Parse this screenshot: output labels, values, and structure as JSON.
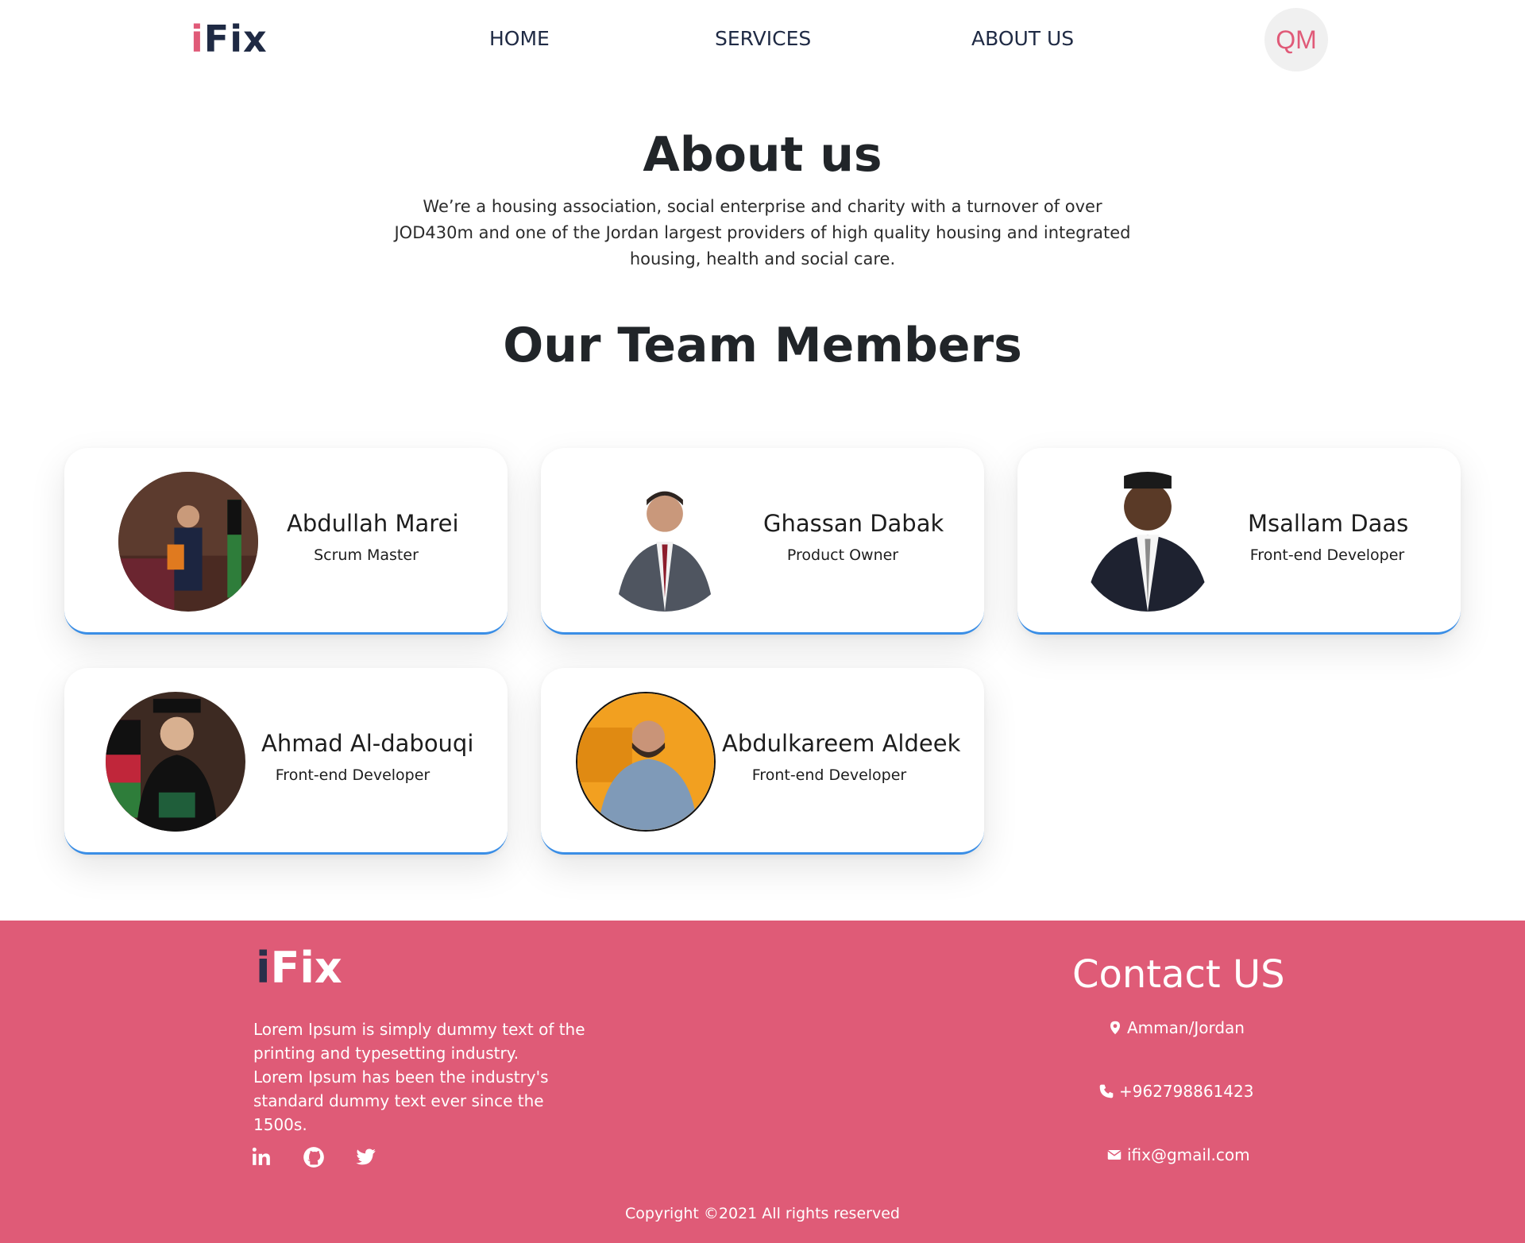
{
  "nav": {
    "logo": "iFix",
    "links": [
      "HOME",
      "SERVICES",
      "ABOUT US"
    ],
    "avatar_initials": "QM"
  },
  "about": {
    "title": "About us",
    "text": "We’re a housing association, social enterprise and charity with a turnover of over JOD430m and one of the Jordan largest providers of high quality housing and integrated housing, health and social care."
  },
  "team": {
    "title": "Our Team Members",
    "members": [
      {
        "name": "Abdullah Marei",
        "role": "Scrum Master"
      },
      {
        "name": "Ghassan Dabak",
        "role": "Product Owner"
      },
      {
        "name": "Msallam Daas",
        "role": "Front-end Developer"
      },
      {
        "name": "Ahmad Al-dabouqi",
        "role": "Front-end Developer"
      },
      {
        "name": "Abdulkareem Aldeek",
        "role": "Front-end Developer"
      }
    ]
  },
  "footer": {
    "logo": "iFix",
    "text_line1": "Lorem Ipsum is simply dummy text of the printing and typesetting industry.",
    "text_line2": "Lorem Ipsum has been the industry's standard dummy text ever since the 1500s.",
    "social_icons": [
      "linkedin-icon",
      "github-icon",
      "twitter-icon"
    ],
    "contact_title": "Contact US",
    "location": "Amman/Jordan",
    "phone": "+962798861423",
    "email": "ifix@gmail.com",
    "copyright": "Copyright ©2021 All rights reserved"
  },
  "colors": {
    "brand_pink": "#df5b77",
    "navy": "#1f2a44",
    "card_accent": "#3a8ee6"
  }
}
